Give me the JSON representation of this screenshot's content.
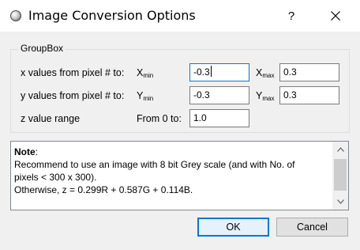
{
  "window": {
    "title": "Image Conversion Options",
    "help_label": "?",
    "close_icon": "close-icon"
  },
  "groupbox": {
    "title": "GroupBox",
    "rows": {
      "x": {
        "label": "x values from pixel # to:",
        "min_label": "X",
        "min_sub": "min",
        "min_value": "-0.3",
        "max_label": "X",
        "max_sub": "max",
        "max_value": "0.3"
      },
      "y": {
        "label": "y values from pixel # to:",
        "min_label": "Y",
        "min_sub": "min",
        "min_value": "-0.3",
        "max_label": "Y",
        "max_sub": "max",
        "max_value": "0.3"
      },
      "z": {
        "label": "z value range",
        "from_label": "From 0 to:",
        "value": "1.0"
      }
    }
  },
  "note": {
    "heading": "Note",
    "heading_colon": ":",
    "line1": "Recommend to use an image with 8 bit Grey scale (and with No. of",
    "line2": "pixels < 300 x 300).",
    "line3": "Otherwise, z = 0.299R + 0.587G + 0.114B."
  },
  "buttons": {
    "ok": "OK",
    "cancel": "Cancel"
  },
  "colors": {
    "accent": "#0078d7",
    "titlebar_bg": "#ffffff",
    "dialog_bg": "#f0f0f0"
  }
}
